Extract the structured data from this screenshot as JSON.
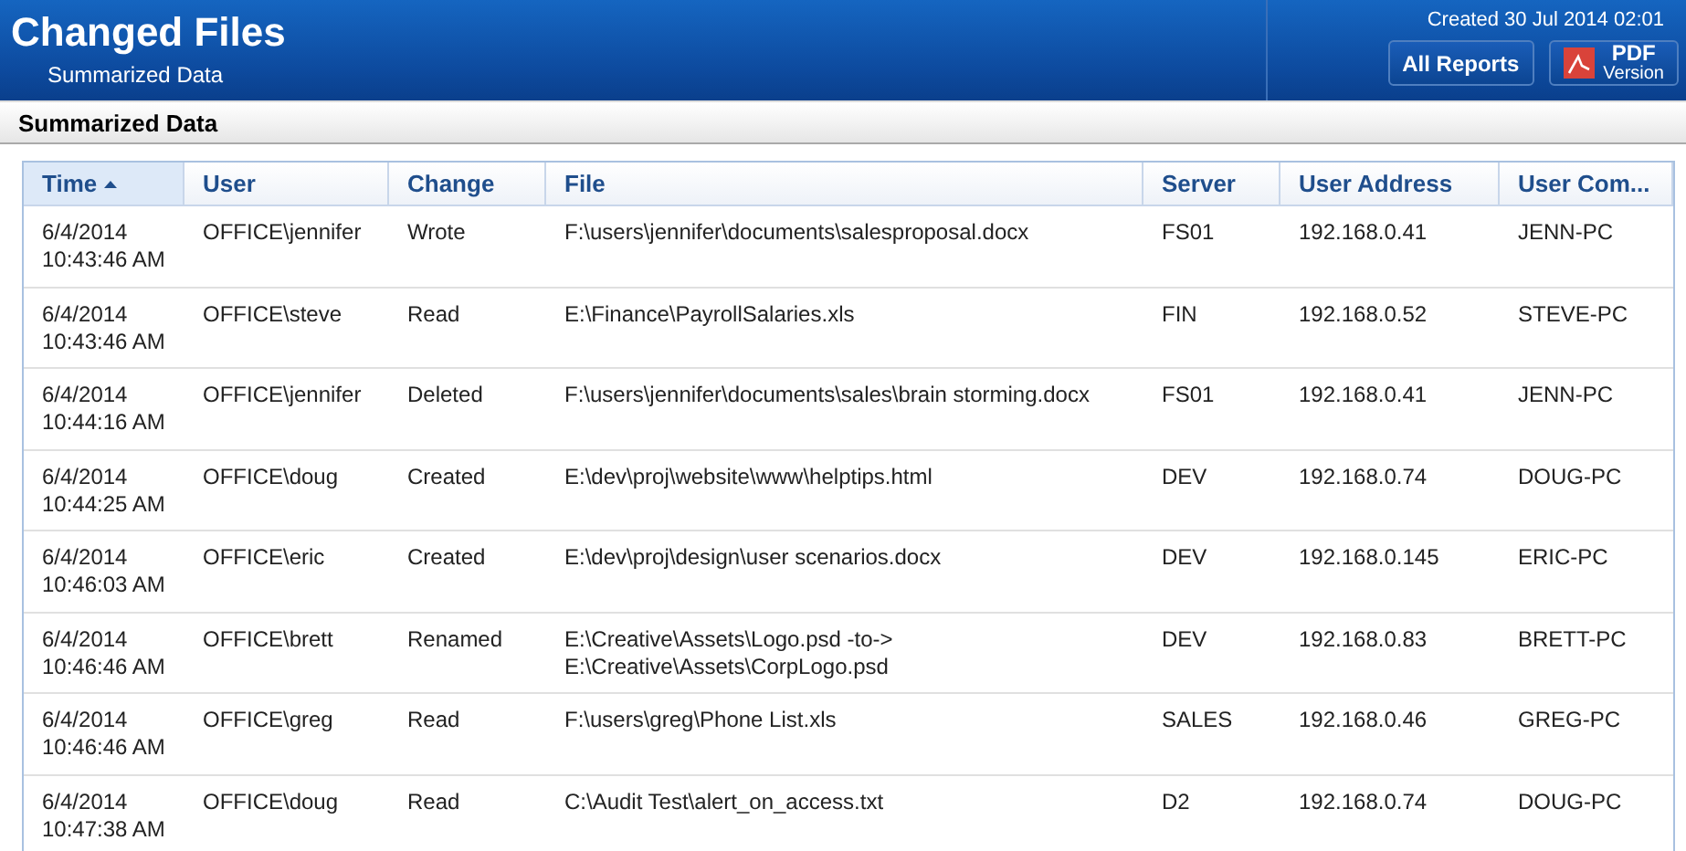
{
  "header": {
    "title": "Changed Files",
    "subtitle": "Summarized Data",
    "created": "Created 30 Jul 2014 02:01",
    "buttons": [
      {
        "kind": "text",
        "label": "All Reports"
      },
      {
        "kind": "pdf",
        "label": "PDF",
        "sublabel": "Version"
      }
    ]
  },
  "section": {
    "title": "Summarized Data"
  },
  "table": {
    "columns": [
      {
        "label": "Time",
        "selected": true
      },
      {
        "label": "User",
        "selected": false
      },
      {
        "label": "Change",
        "selected": false
      },
      {
        "label": "File",
        "selected": false
      },
      {
        "label": "Server",
        "selected": false
      },
      {
        "label": "User Address",
        "selected": false
      },
      {
        "label": "User Com...",
        "selected": false
      }
    ],
    "rows": [
      {
        "date": "6/4/2014",
        "time": "10:43:46 AM",
        "user": "OFFICE\\jennifer",
        "change": "Wrote",
        "file": "F:\\users\\jennifer\\documents\\salesproposal.docx",
        "server": "FS01",
        "address": "192.168.0.41",
        "computer": "JENN-PC"
      },
      {
        "date": "6/4/2014",
        "time": "10:43:46 AM",
        "user": "OFFICE\\steve",
        "change": "Read",
        "file": "E:\\Finance\\PayrollSalaries.xls",
        "server": "FIN",
        "address": "192.168.0.52",
        "computer": "STEVE-PC"
      },
      {
        "date": "6/4/2014",
        "time": "10:44:16 AM",
        "user": "OFFICE\\jennifer",
        "change": "Deleted",
        "file": "F:\\users\\jennifer\\documents\\sales\\brain storming.docx",
        "server": "FS01",
        "address": "192.168.0.41",
        "computer": "JENN-PC"
      },
      {
        "date": "6/4/2014",
        "time": "10:44:25 AM",
        "user": "OFFICE\\doug",
        "change": "Created",
        "file": "E:\\dev\\proj\\website\\www\\helptips.html",
        "server": "DEV",
        "address": "192.168.0.74",
        "computer": "DOUG-PC"
      },
      {
        "date": "6/4/2014",
        "time": "10:46:03 AM",
        "user": "OFFICE\\eric",
        "change": "Created",
        "file": "E:\\dev\\proj\\design\\user scenarios.docx",
        "server": "DEV",
        "address": "192.168.0.145",
        "computer": "ERIC-PC"
      },
      {
        "date": "6/4/2014",
        "time": "10:46:46 AM",
        "user": "OFFICE\\brett",
        "change": "Renamed",
        "file": "E:\\Creative\\Assets\\Logo.psd -to->\nE:\\Creative\\Assets\\CorpLogo.psd",
        "server": "DEV",
        "address": "192.168.0.83",
        "computer": "BRETT-PC"
      },
      {
        "date": "6/4/2014",
        "time": "10:46:46 AM",
        "user": "OFFICE\\greg",
        "change": "Read",
        "file": "F:\\users\\greg\\Phone List.xls",
        "server": "SALES",
        "address": "192.168.0.46",
        "computer": "GREG-PC"
      },
      {
        "date": "6/4/2014",
        "time": "10:47:38 AM",
        "user": "OFFICE\\doug",
        "change": "Read",
        "file": "C:\\Audit Test\\alert_on_access.txt",
        "server": "D2",
        "address": "192.168.0.74",
        "computer": "DOUG-PC"
      }
    ]
  }
}
